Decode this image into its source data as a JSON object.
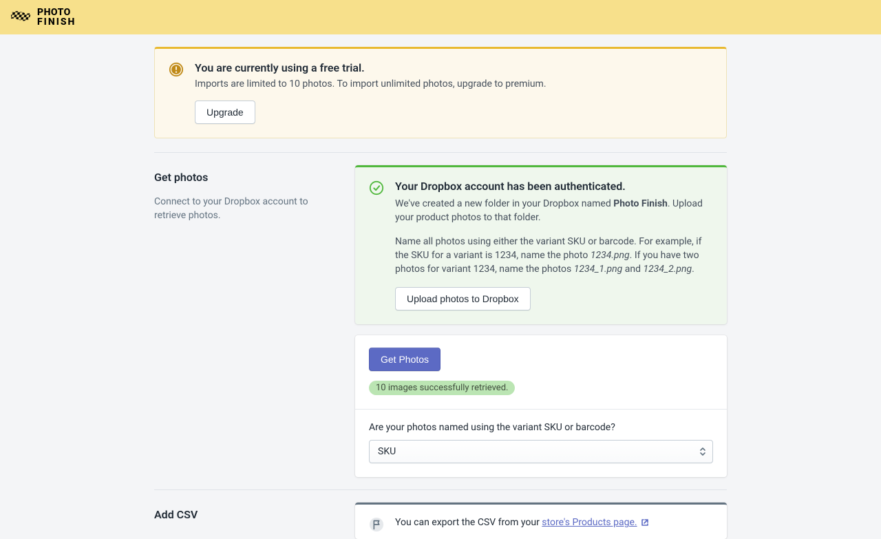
{
  "brand": {
    "name_line1": "PHOTO",
    "name_line2": "FINISH"
  },
  "trial_banner": {
    "title": "You are currently using a free trial.",
    "body": "Imports are limited to 10 photos. To import unlimited photos, upgrade to premium.",
    "upgrade_label": "Upgrade"
  },
  "get_photos_section": {
    "heading": "Get photos",
    "description": "Connect to your Dropbox account to retrieve photos."
  },
  "dropbox_banner": {
    "title": "Your Dropbox account has been authenticated.",
    "p1_a": "We've created a new folder in your Dropbox named ",
    "p1_b_bold": "Photo Finish",
    "p1_c": ". Upload your product photos to that folder.",
    "p2_a": "Name all photos using either the variant SKU or barcode. For example, if the SKU for a variant is 1234, name the photo ",
    "p2_b_italic": "1234.png",
    "p2_c": ". If you have two photos for variant 1234, name the photos ",
    "p2_d_italic": "1234_1.png",
    "p2_e": " and ",
    "p2_f_italic": "1234_2.png",
    "p2_g": ".",
    "upload_button": "Upload photos to Dropbox"
  },
  "photos_card": {
    "get_button": "Get Photos",
    "status_badge": "10 images successfully retrieved.",
    "naming_question": "Are your photos named using the variant SKU or barcode?",
    "select_value": "SKU"
  },
  "csv_section": {
    "heading": "Add CSV",
    "info_a": "You can export the CSV from your ",
    "info_link": "store's Products page."
  }
}
